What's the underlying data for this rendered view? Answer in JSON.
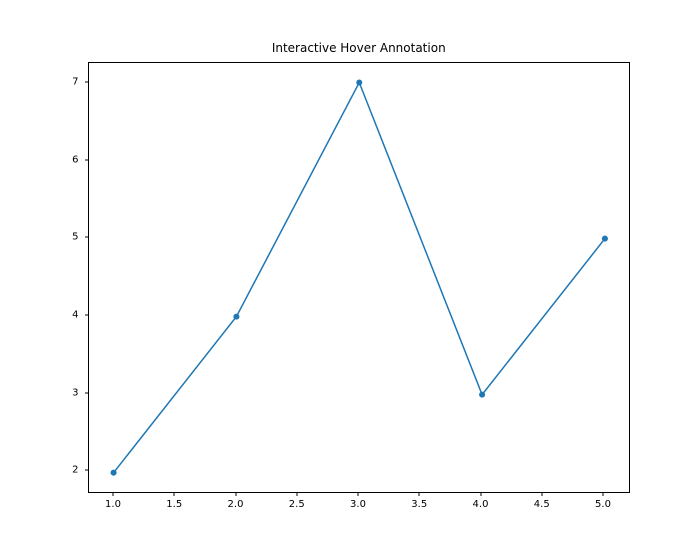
{
  "chart_data": {
    "type": "line",
    "title": "Interactive Hover Annotation",
    "x": [
      1,
      2,
      3,
      4,
      5
    ],
    "y": [
      2,
      4,
      7,
      3,
      5
    ],
    "xlim": [
      0.8,
      5.2
    ],
    "ylim": [
      1.75,
      7.25
    ],
    "xticks": [
      1.0,
      1.5,
      2.0,
      2.5,
      3.0,
      3.5,
      4.0,
      4.5,
      5.0
    ],
    "xtick_labels": [
      "1.0",
      "1.5",
      "2.0",
      "2.5",
      "3.0",
      "3.5",
      "4.0",
      "4.5",
      "5.0"
    ],
    "yticks": [
      2,
      3,
      4,
      5,
      6,
      7
    ],
    "ytick_labels": [
      "2",
      "3",
      "4",
      "5",
      "6",
      "7"
    ],
    "line_color": "#1f77b4",
    "marker_radius": 3
  }
}
